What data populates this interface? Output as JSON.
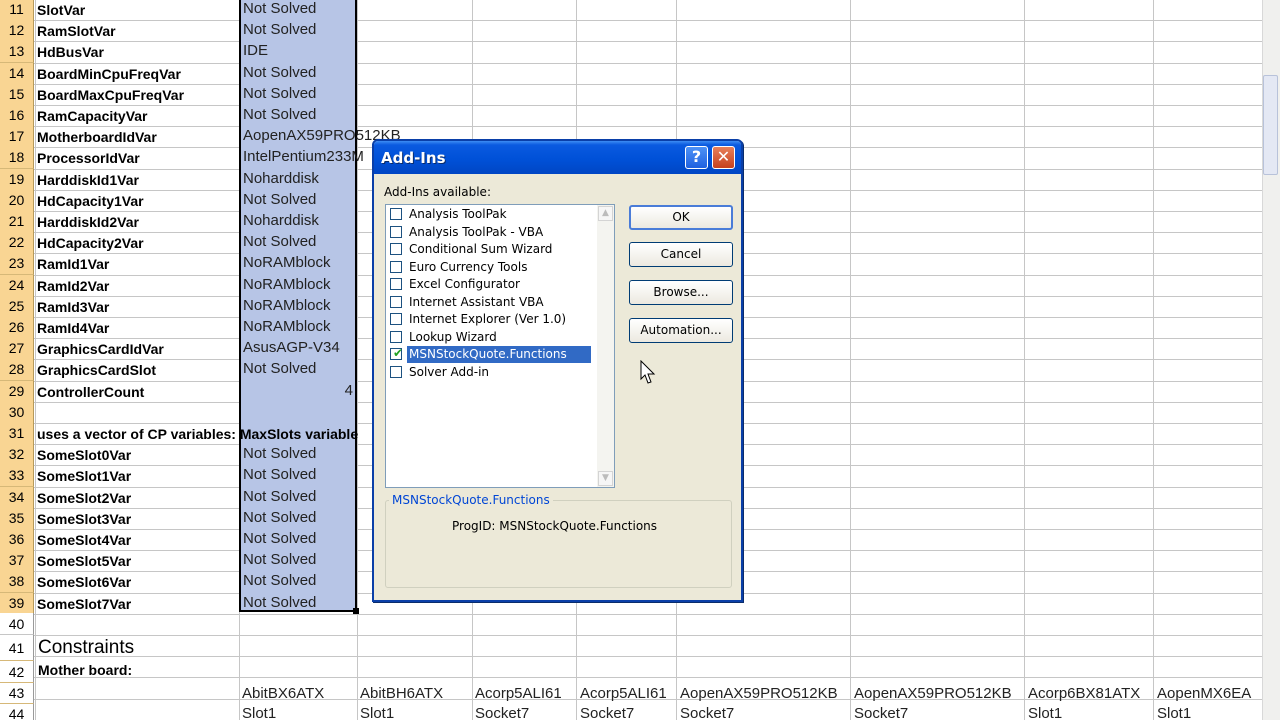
{
  "sheet": {
    "rows": [
      {
        "num": "11",
        "name": "SlotVar",
        "value": "Not Solved"
      },
      {
        "num": "12",
        "name": "RamSlotVar",
        "value": "Not Solved"
      },
      {
        "num": "13",
        "name": "HdBusVar",
        "value": "IDE"
      },
      {
        "num": "14",
        "name": "BoardMinCpuFreqVar",
        "value": "Not Solved"
      },
      {
        "num": "15",
        "name": "BoardMaxCpuFreqVar",
        "value": "Not Solved"
      },
      {
        "num": "16",
        "name": "RamCapacityVar",
        "value": "Not Solved"
      },
      {
        "num": "17",
        "name": "MotherboardIdVar",
        "value": "AopenAX59PRO512KB"
      },
      {
        "num": "18",
        "name": "ProcessorIdVar",
        "value": "IntelPentium233M"
      },
      {
        "num": "19",
        "name": "HarddiskId1Var",
        "value": "Noharddisk"
      },
      {
        "num": "20",
        "name": "HdCapacity1Var",
        "value": "Not Solved"
      },
      {
        "num": "21",
        "name": "HarddiskId2Var",
        "value": "Noharddisk"
      },
      {
        "num": "22",
        "name": "HdCapacity2Var",
        "value": "Not Solved"
      },
      {
        "num": "23",
        "name": "RamId1Var",
        "value": "NoRAMblock"
      },
      {
        "num": "24",
        "name": "RamId2Var",
        "value": "NoRAMblock"
      },
      {
        "num": "25",
        "name": "RamId3Var",
        "value": "NoRAMblock"
      },
      {
        "num": "26",
        "name": "RamId4Var",
        "value": "NoRAMblock"
      },
      {
        "num": "27",
        "name": "GraphicsCardIdVar",
        "value": "AsusAGP-V34"
      },
      {
        "num": "28",
        "name": "GraphicsCardSlot",
        "value": "Not Solved"
      },
      {
        "num": "29",
        "name": "ControllerCount",
        "value": "4"
      },
      {
        "num": "30",
        "name": "",
        "value": ""
      },
      {
        "num": "31",
        "name": "uses a vector of CP variables: MaxSlots variable",
        "value": ""
      },
      {
        "num": "32",
        "name": "SomeSlot0Var",
        "value": "Not Solved"
      },
      {
        "num": "33",
        "name": "SomeSlot1Var",
        "value": "Not Solved"
      },
      {
        "num": "34",
        "name": "SomeSlot2Var",
        "value": "Not Solved"
      },
      {
        "num": "35",
        "name": "SomeSlot3Var",
        "value": "Not Solved"
      },
      {
        "num": "36",
        "name": "SomeSlot4Var",
        "value": "Not Solved"
      },
      {
        "num": "37",
        "name": "SomeSlot5Var",
        "value": "Not Solved"
      },
      {
        "num": "38",
        "name": "SomeSlot6Var",
        "value": "Not Solved"
      },
      {
        "num": "39",
        "name": "SomeSlot7Var",
        "value": "Not Solved"
      }
    ],
    "row40": "40",
    "row41": "41",
    "row42": "42",
    "row43": "43",
    "row44": "44",
    "constraints_title": "Constraints",
    "motherboard_label": "Mother board:",
    "row43_cells": [
      "AbitBX6ATX",
      "AbitBH6ATX",
      "Acorp5ALI61",
      "Acorp5ALI61",
      "AopenAX59PRO512KB",
      "AopenAX59PRO512KB",
      "Acorp6BX81ATX",
      "AopenMX6EA"
    ],
    "row44_cells": [
      "Slot1",
      "Slot1",
      "Socket7",
      "Socket7",
      "Socket7",
      "Socket7",
      "Slot1",
      "Slot1"
    ]
  },
  "dialog": {
    "title": "Add-Ins",
    "help_glyph": "?",
    "close_glyph": "✕",
    "available_label": "Add-Ins available:",
    "items": [
      {
        "label": "Analysis ToolPak",
        "checked": false
      },
      {
        "label": "Analysis ToolPak - VBA",
        "checked": false
      },
      {
        "label": "Conditional Sum Wizard",
        "checked": false
      },
      {
        "label": "Euro Currency Tools",
        "checked": false
      },
      {
        "label": "Excel Configurator",
        "checked": false
      },
      {
        "label": "Internet Assistant VBA",
        "checked": false
      },
      {
        "label": "Internet Explorer (Ver 1.0)",
        "checked": false
      },
      {
        "label": "Lookup Wizard",
        "checked": false
      },
      {
        "label": "MSNStockQuote.Functions",
        "checked": true,
        "selected": true
      },
      {
        "label": "Solver Add-in",
        "checked": false
      }
    ],
    "ok_label": "OK",
    "cancel_label": "Cancel",
    "browse_label": "Browse...",
    "automation_label": "Automation...",
    "group_title": "MSNStockQuote.Functions",
    "progid_text": "ProgID: MSNStockQuote.Functions"
  },
  "colors": {
    "selection_fill": "#b7c5e6",
    "row_header": "#f9d593",
    "title_bar": "#0051d8",
    "list_selection": "#316ac5"
  }
}
